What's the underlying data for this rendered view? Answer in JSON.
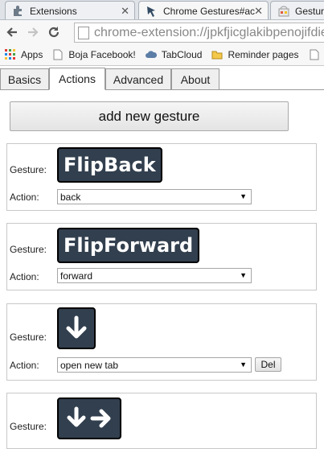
{
  "browser": {
    "tabs": [
      {
        "title": "Extensions",
        "icon": "puzzle-icon"
      },
      {
        "title": "Chrome Gestures#ac",
        "icon": "gesture-cursor-icon"
      },
      {
        "title": "Gesture",
        "icon": "store-icon"
      }
    ],
    "address": "chrome-extension://jpkfjicglakibpenojifdie",
    "bookmarks": [
      {
        "label": "Apps",
        "icon": "apps-grid-icon"
      },
      {
        "label": "Boja Facebook!",
        "icon": "page-icon"
      },
      {
        "label": "TabCloud",
        "icon": "cloud-icon"
      },
      {
        "label": "Reminder pages",
        "icon": "folder-icon"
      }
    ]
  },
  "page_tabs": [
    "Basics",
    "Actions",
    "Advanced",
    "About"
  ],
  "add_button": "add new gesture",
  "labels": {
    "gesture": "Gesture:",
    "action": "Action:",
    "del": "Del"
  },
  "gestures": [
    {
      "glyph": "FlipBack",
      "action": "back"
    },
    {
      "glyph": "FlipForward",
      "action": "forward"
    },
    {
      "glyph": "down-arrow",
      "action": "open new tab"
    },
    {
      "glyph": "down-right-arrows",
      "action": ""
    }
  ],
  "colors": {
    "glyph_bg": "#323f4e",
    "tab_active": "#ffffff"
  }
}
